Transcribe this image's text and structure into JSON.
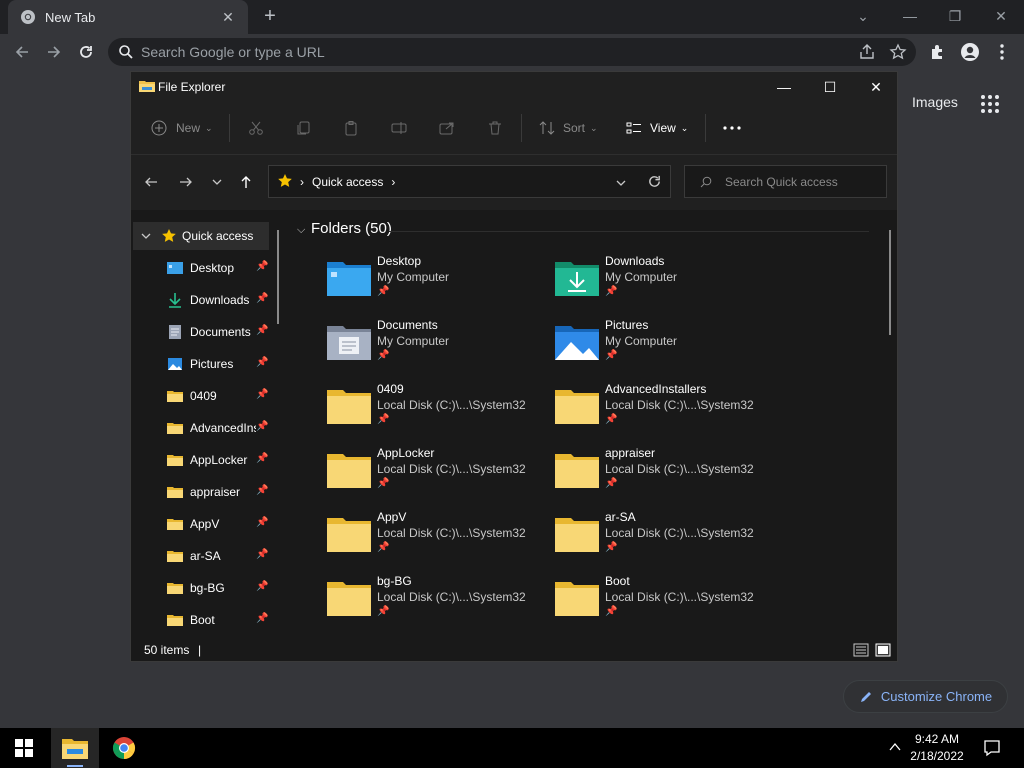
{
  "chrome": {
    "tab_title": "New Tab",
    "omnibox_placeholder": "Search Google or type a URL",
    "images_link": "Images",
    "customize_label": "Customize Chrome"
  },
  "explorer": {
    "window_title": "File Explorer",
    "commands": {
      "new": "New",
      "sort": "Sort",
      "view": "View"
    },
    "breadcrumb": "Quick access",
    "search_placeholder": "Search Quick access",
    "nav": [
      {
        "label": "Quick access"
      },
      {
        "label": "Desktop"
      },
      {
        "label": "Downloads"
      },
      {
        "label": "Documents"
      },
      {
        "label": "Pictures"
      },
      {
        "label": "0409"
      },
      {
        "label": "AdvancedInstallers"
      },
      {
        "label": "AppLocker"
      },
      {
        "label": "appraiser"
      },
      {
        "label": "AppV"
      },
      {
        "label": "ar-SA"
      },
      {
        "label": "bg-BG"
      },
      {
        "label": "Boot"
      }
    ],
    "folders_header": "Folders (50)",
    "folders": [
      {
        "name": "Desktop",
        "location": "My Computer",
        "icon": "desktop-folder-icon"
      },
      {
        "name": "Downloads",
        "location": "My Computer",
        "icon": "downloads-folder-icon"
      },
      {
        "name": "Documents",
        "location": "My Computer",
        "icon": "documents-folder-icon"
      },
      {
        "name": "Pictures",
        "location": "My Computer",
        "icon": "pictures-folder-icon"
      },
      {
        "name": "0409",
        "location": "Local Disk (C:)\\...\\System32",
        "icon": "folder-icon"
      },
      {
        "name": "AdvancedInstallers",
        "location": "Local Disk (C:)\\...\\System32",
        "icon": "folder-icon"
      },
      {
        "name": "AppLocker",
        "location": "Local Disk (C:)\\...\\System32",
        "icon": "folder-icon"
      },
      {
        "name": "appraiser",
        "location": "Local Disk (C:)\\...\\System32",
        "icon": "folder-icon"
      },
      {
        "name": "AppV",
        "location": "Local Disk (C:)\\...\\System32",
        "icon": "folder-icon"
      },
      {
        "name": "ar-SA",
        "location": "Local Disk (C:)\\...\\System32",
        "icon": "folder-icon"
      },
      {
        "name": "bg-BG",
        "location": "Local Disk (C:)\\...\\System32",
        "icon": "folder-icon"
      },
      {
        "name": "Boot",
        "location": "Local Disk (C:)\\...\\System32",
        "icon": "folder-icon"
      }
    ],
    "status_count": "50 items"
  },
  "taskbar": {
    "time": "9:42 AM",
    "date": "2/18/2022"
  },
  "colors": {
    "accent": "#8ab4f8",
    "folder_yellow": "#f8d775",
    "chrome_bg": "#35363a",
    "explorer_bg": "#191919"
  }
}
